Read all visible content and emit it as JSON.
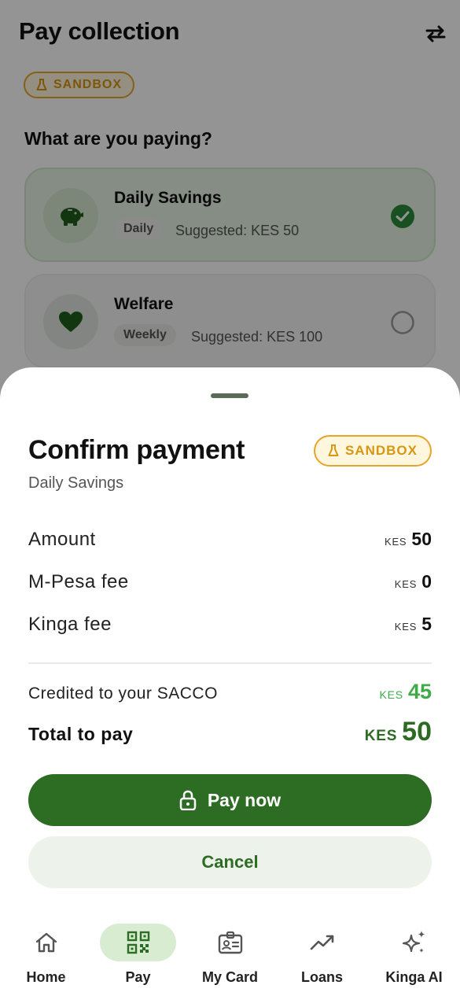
{
  "header": {
    "title": "Pay collection",
    "swap_icon": "swap-arrows-icon"
  },
  "badge": {
    "label": "SANDBOX",
    "icon": "flask-icon"
  },
  "question": "What are you paying?",
  "options": [
    {
      "title": "Daily Savings",
      "frequency": "Daily",
      "suggested": "Suggested: KES 50",
      "icon": "piggy-bank-icon",
      "selected": true
    },
    {
      "title": "Welfare",
      "frequency": "Weekly",
      "suggested": "Suggested: KES 100",
      "icon": "heart-icon",
      "selected": false
    }
  ],
  "sheet": {
    "title": "Confirm payment",
    "subtitle": "Daily Savings",
    "badge": "SANDBOX",
    "rows": [
      {
        "label": "Amount",
        "currency": "KES",
        "value": "50"
      },
      {
        "label": "M-Pesa fee",
        "currency": "KES",
        "value": "0"
      },
      {
        "label": "Kinga fee",
        "currency": "KES",
        "value": "5"
      }
    ],
    "credited": {
      "label": "Credited to your SACCO",
      "currency": "KES",
      "value": "45"
    },
    "total": {
      "label": "Total to pay",
      "currency": "KES",
      "value": "50"
    },
    "pay_button": "Pay now",
    "cancel_button": "Cancel"
  },
  "nav": [
    {
      "label": "Home",
      "icon": "home-icon",
      "active": false
    },
    {
      "label": "Pay",
      "icon": "qr-code-icon",
      "active": true
    },
    {
      "label": "My Card",
      "icon": "id-card-icon",
      "active": false
    },
    {
      "label": "Loans",
      "icon": "trending-up-icon",
      "active": false
    },
    {
      "label": "Kinga AI",
      "icon": "sparkles-icon",
      "active": false
    }
  ],
  "colors": {
    "primary": "#2c6c23",
    "accent_green": "#3faa4a",
    "sandbox": "#d69712"
  }
}
